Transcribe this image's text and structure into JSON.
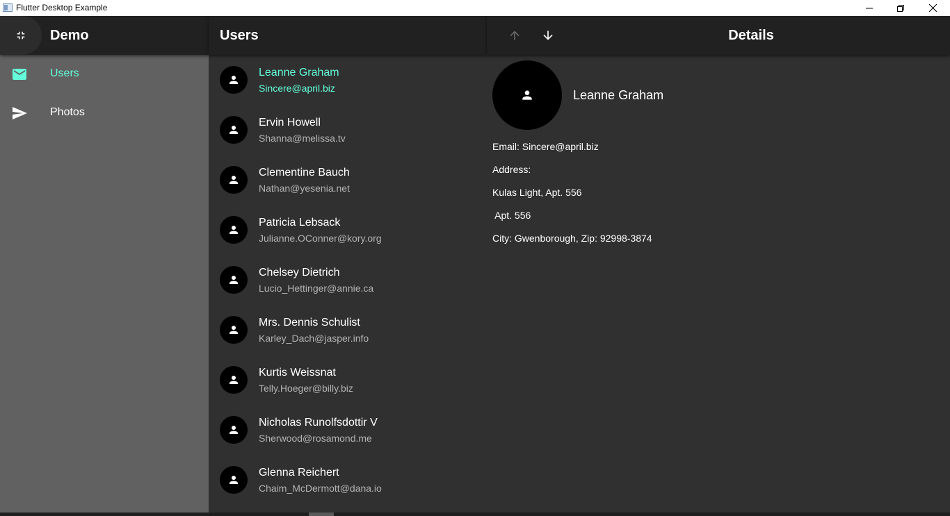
{
  "window": {
    "title": "Flutter Desktop Example",
    "controls": [
      "minimize-icon",
      "restore-icon",
      "close-icon"
    ]
  },
  "nav": {
    "title": "Demo",
    "collapse_icon": "collapse-icon",
    "items": [
      {
        "label": "Users",
        "icon": "mail-icon",
        "selected": true
      },
      {
        "label": "Photos",
        "icon": "send-icon",
        "selected": false
      }
    ]
  },
  "list": {
    "title": "Users",
    "users": [
      {
        "name": "Leanne Graham",
        "email": "Sincere@april.biz",
        "selected": true
      },
      {
        "name": "Ervin Howell",
        "email": "Shanna@melissa.tv"
      },
      {
        "name": "Clementine Bauch",
        "email": "Nathan@yesenia.net"
      },
      {
        "name": "Patricia Lebsack",
        "email": "Julianne.OConner@kory.org"
      },
      {
        "name": "Chelsey Dietrich",
        "email": "Lucio_Hettinger@annie.ca"
      },
      {
        "name": "Mrs. Dennis Schulist",
        "email": "Karley_Dach@jasper.info"
      },
      {
        "name": "Kurtis Weissnat",
        "email": "Telly.Hoeger@billy.biz"
      },
      {
        "name": "Nicholas Runolfsdottir V",
        "email": "Sherwood@rosamond.me"
      },
      {
        "name": "Glenna Reichert",
        "email": "Chaim_McDermott@dana.io"
      }
    ]
  },
  "details": {
    "title": "Details",
    "name": "Leanne Graham",
    "email_line": "Email: Sincere@april.biz",
    "address_label": "Address:",
    "street_line": "Kulas Light, Apt. 556",
    "suite_line": " Apt. 556",
    "city_line": "City: Gwenborough, Zip: 92998-3874"
  },
  "colors": {
    "accent": "#64ffda",
    "header_bg": "#212121",
    "nav_bg": "#616161",
    "content_bg": "#303030"
  }
}
